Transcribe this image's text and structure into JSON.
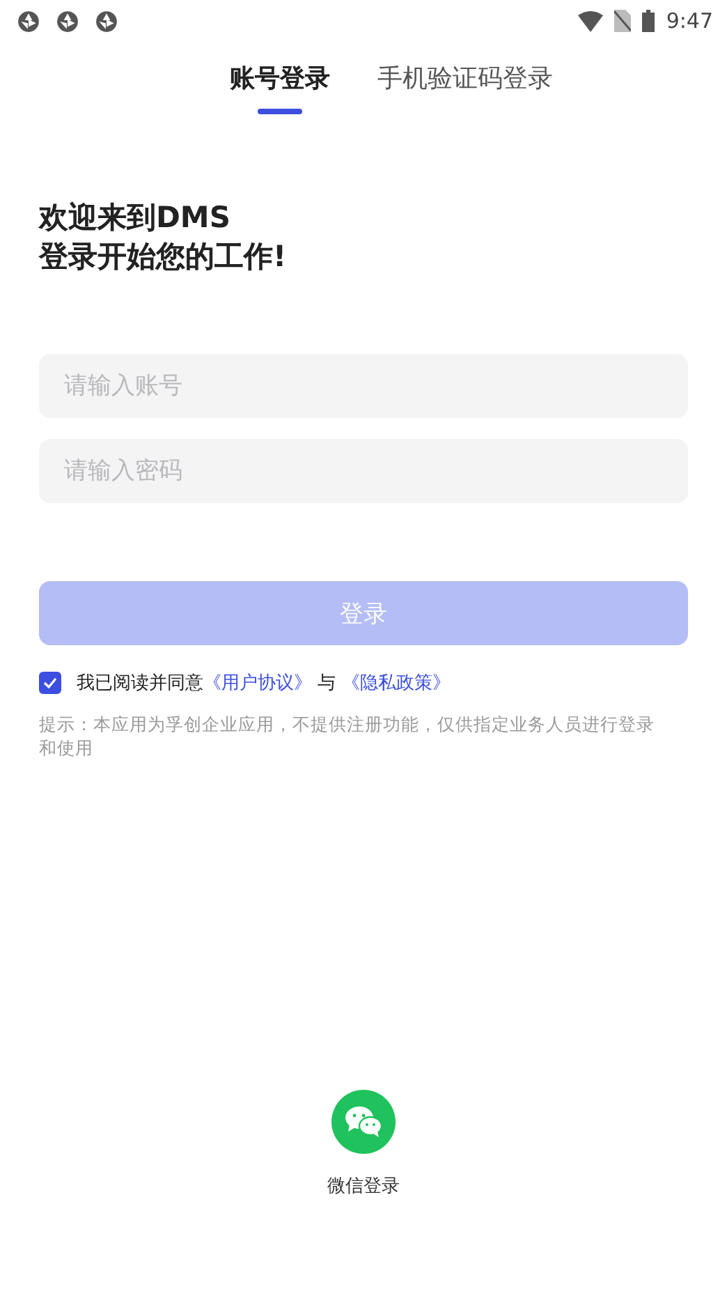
{
  "status_bar": {
    "time": "9:47"
  },
  "tabs": [
    {
      "label": "账号登录",
      "selected": true
    },
    {
      "label": "手机验证码登录",
      "selected": false
    }
  ],
  "heading": [
    "欢迎来到DMS",
    "登录开始您的工作!"
  ],
  "fields": [
    {
      "placeholder": "请输入账号"
    },
    {
      "placeholder": "请输入密码"
    }
  ],
  "login_button": {
    "label": "登录",
    "disabled": true
  },
  "agreement": {
    "checked": true,
    "text": "我已阅读并同意",
    "link_1": "《用户协议》",
    "joiner": "与",
    "link_2": "《隐私政策》"
  },
  "hint": "提示：本应用为孚创企业应用，不提供注册功能，仅供指定业务人员进行登录和使用",
  "wechat_login": {
    "label": "微信登录"
  }
}
